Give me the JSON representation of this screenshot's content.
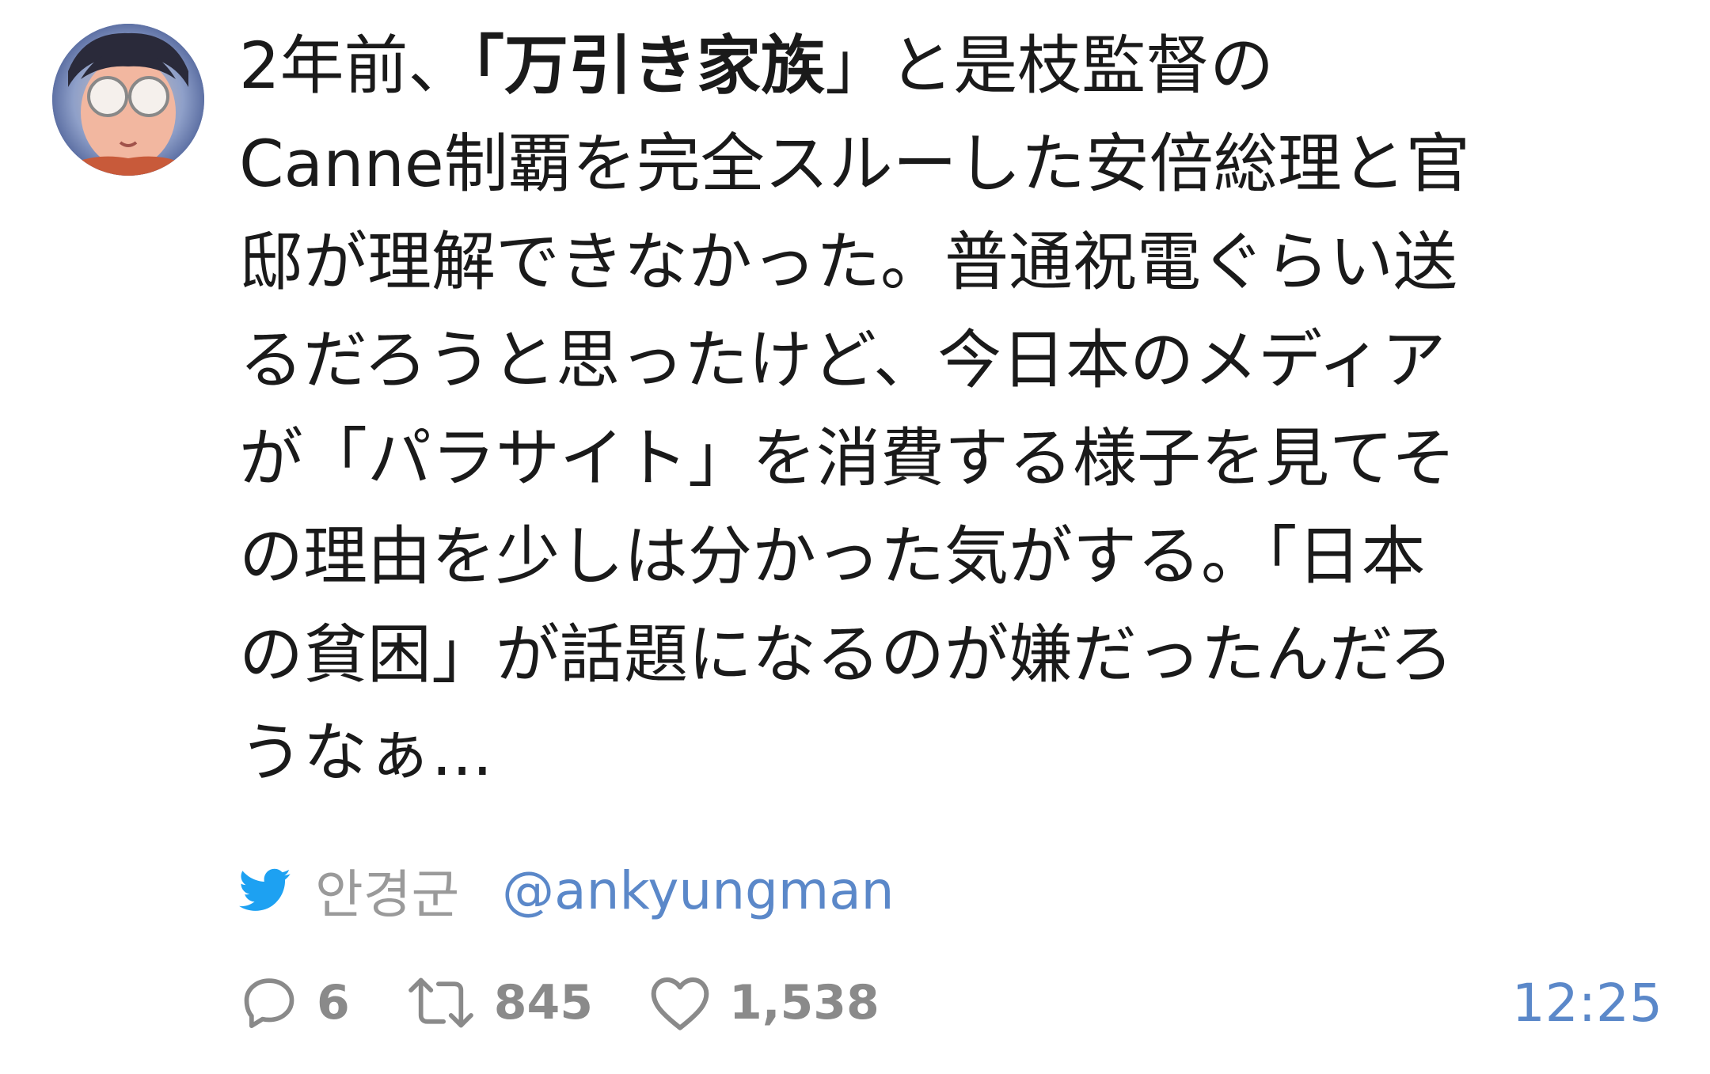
{
  "tweet": {
    "text_lines": [
      {
        "before": "2年前、",
        "bold": "「万引き家族",
        "after": "」と是枝監督の"
      },
      "Canne制覇を完全スルーした安倍総理と官",
      "邸が理解できなかった。普通祝電ぐらい送",
      "るだろうと思ったけど、今日本のメディア",
      "が「パラサイト」を消費する様子を見てそ",
      "の理由を少しは分かった気がする。「日本",
      "の貧困」が話題になるのが嫌だったんだろ",
      "うなぁ..."
    ],
    "author": {
      "name": "안경군",
      "handle": "@ankyungman"
    },
    "stats": {
      "replies": "6",
      "retweets": "845",
      "likes": "1,538"
    },
    "time": "12:25"
  },
  "colors": {
    "text": "#1a1a1a",
    "muted": "#8a8a8a",
    "link": "#5b88c9",
    "twitter_blue": "#1da1f2"
  },
  "icons": {
    "avatar": "avatar-image",
    "source": "twitter-bird-icon",
    "reply": "reply-icon",
    "retweet": "retweet-icon",
    "like": "heart-icon"
  }
}
